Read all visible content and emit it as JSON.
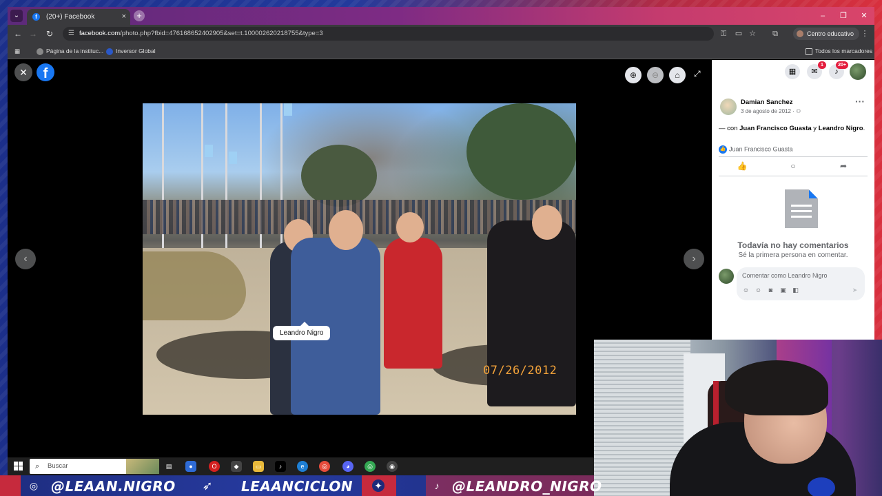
{
  "browser": {
    "tab_title": "(20+) Facebook",
    "tab_close": "×",
    "new_tab": "+",
    "window_min": "–",
    "window_max": "❐",
    "window_close": "✕",
    "url_host": "facebook.com",
    "url_path": "/photo.php?fbid=476168652402905&set=t.100002620218755&type=3",
    "profile_label": "Centro educativo",
    "bookmarks": [
      {
        "label": "Página de la instituc..."
      },
      {
        "label": "Inversor Global"
      }
    ],
    "all_bookmarks": "Todos los marcadores"
  },
  "viewer": {
    "close_glyph": "✕",
    "logo_glyph": "f",
    "tag_name": "Leandro Nigro",
    "date_stamp": "07/26/2012",
    "prev_glyph": "‹",
    "next_glyph": "›"
  },
  "panel": {
    "messenger_badge": "1",
    "notifications_badge": "20+",
    "poster_name": "Damian Sanchez",
    "post_date": "3 de agosto de 2012 ·",
    "caption_prefix": "— con ",
    "tagged_1": "Juan Francisco Guasta",
    "caption_and": " y ",
    "tagged_2": "Leandro Nigro",
    "caption_end": ".",
    "likes_text": "Juan Francisco Guasta",
    "no_comments_title": "Todavía no hay comentarios",
    "no_comments_sub": "Sé la primera persona en comentar.",
    "comment_placeholder": "Comentar como Leandro Nigro"
  },
  "taskbar": {
    "search_label": "Buscar"
  },
  "footer": {
    "handle_instagram": "@LEAAN.NIGRO",
    "handle_twitter": "LEAANCICLON",
    "handle_tiktok": "@LEANDRO_NIGRO"
  }
}
